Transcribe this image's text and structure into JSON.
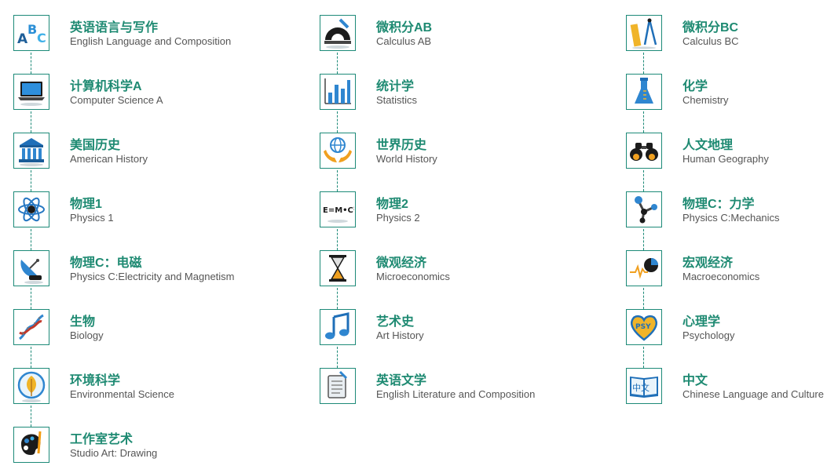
{
  "columns": [
    [
      {
        "cn": "英语语言与写作",
        "en": "English Language and Composition",
        "icon": "abc-blocks-icon"
      },
      {
        "cn": "计算机科学A",
        "en": "Computer Science A",
        "icon": "laptop-icon"
      },
      {
        "cn": "美国历史",
        "en": "American History",
        "icon": "museum-icon"
      },
      {
        "cn": "物理1",
        "en": "Physics 1",
        "icon": "atom-icon"
      },
      {
        "cn": "物理C：电磁",
        "en": "Physics C:Electricity and Magnetism",
        "icon": "satellite-dish-icon"
      },
      {
        "cn": "生物",
        "en": "Biology",
        "icon": "dna-icon"
      },
      {
        "cn": "环境科学",
        "en": "Environmental Science",
        "icon": "leaf-icon"
      },
      {
        "cn": "工作室艺术",
        "en": "Studio Art: Drawing",
        "icon": "palette-icon"
      }
    ],
    [
      {
        "cn": "微积分AB",
        "en": "Calculus AB",
        "icon": "protractor-icon"
      },
      {
        "cn": "统计学",
        "en": "Statistics",
        "icon": "bar-chart-icon"
      },
      {
        "cn": "世界历史",
        "en": "World History",
        "icon": "globe-hands-icon"
      },
      {
        "cn": "物理2",
        "en": "Physics 2",
        "icon": "formula-icon",
        "icon_text": "E=M•C²"
      },
      {
        "cn": "微观经济",
        "en": "Microeconomics",
        "icon": "hourglass-icon"
      },
      {
        "cn": "艺术史",
        "en": "Art History",
        "icon": "music-note-icon"
      },
      {
        "cn": "英语文学",
        "en": "English Literature and Composition",
        "icon": "notebook-pen-icon"
      }
    ],
    [
      {
        "cn": "微积分BC",
        "en": "Calculus BC",
        "icon": "ruler-compass-icon"
      },
      {
        "cn": "化学",
        "en": "Chemistry",
        "icon": "flask-icon"
      },
      {
        "cn": "人文地理",
        "en": "Human Geography",
        "icon": "binoculars-icon"
      },
      {
        "cn": "物理C：力学",
        "en": "Physics C:Mechanics",
        "icon": "molecule-icon"
      },
      {
        "cn": "宏观经济",
        "en": "Macroeconomics",
        "icon": "pie-chart-icon"
      },
      {
        "cn": "心理学",
        "en": "Psychology",
        "icon": "psy-heart-icon",
        "icon_text": "PSY"
      },
      {
        "cn": "中文",
        "en": "Chinese Language and Culture",
        "icon": "chinese-book-icon",
        "icon_text": "中文"
      }
    ]
  ]
}
